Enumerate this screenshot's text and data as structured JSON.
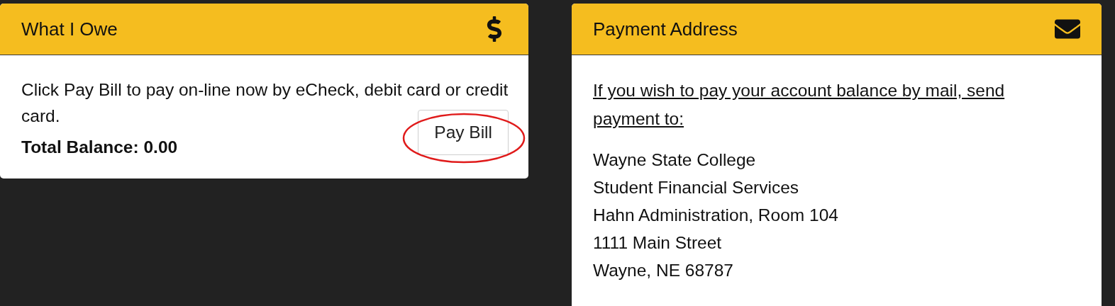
{
  "owe": {
    "title": "What I Owe",
    "text": "Click Pay Bill to pay on-line now by eCheck, debit card or credit card.",
    "button": {
      "label": "Pay Bill",
      "highlighted": true
    },
    "balance": "Total Balance: 0.00"
  },
  "address": {
    "title": "Payment Address",
    "intro": "If you wish to pay your account balance by mail, send payment to:",
    "lines": [
      "Wayne State College",
      "Student Financial Services",
      "Hahn Administration, Room 104",
      "1111 Main Street",
      "Wayne, NE 68787"
    ]
  }
}
